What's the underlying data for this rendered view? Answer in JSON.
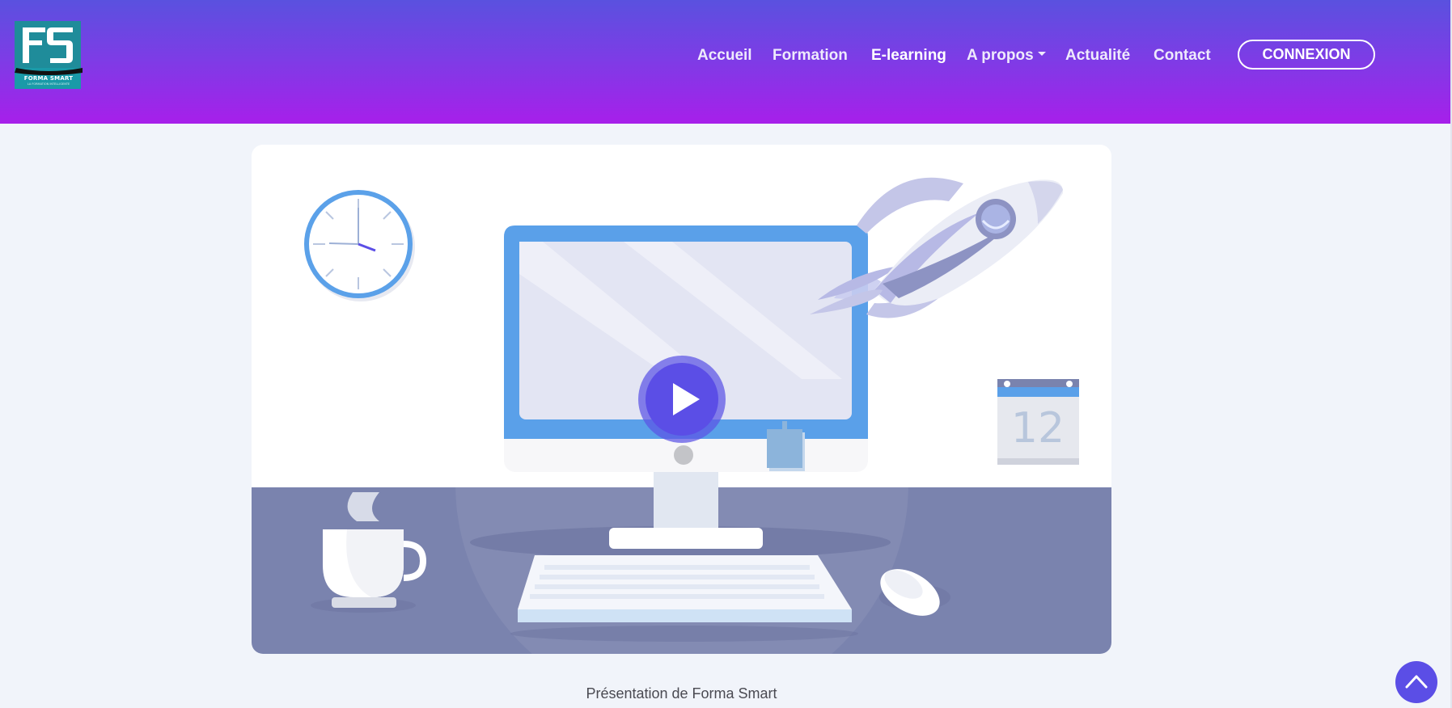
{
  "brand": {
    "logo_letters": "FS",
    "logo_name": "FORMA SMART",
    "logo_tagline": "LA FORMATION INTELLIGENTE"
  },
  "nav": {
    "items": [
      {
        "label": "Accueil"
      },
      {
        "label": "Formation"
      },
      {
        "label": "E-learning",
        "active": true
      },
      {
        "label": "A propos",
        "dropdown": true
      },
      {
        "label": "Actualité"
      },
      {
        "label": "Contact"
      }
    ],
    "login_label": "CONNEXION"
  },
  "video": {
    "thumbnail_icons": [
      "clock-icon",
      "rocket-icon",
      "calendar-icon",
      "monitor-icon",
      "coffee-cup-icon",
      "keyboard-icon",
      "mouse-icon"
    ],
    "calendar_day": "12",
    "play_icon": "play-icon"
  },
  "caption": "Présentation de Forma Smart",
  "back_to_top_icon": "chevron-up-icon",
  "colors": {
    "header_top": "#5a51df",
    "header_bottom": "#a71fea",
    "accent": "#5b4ee6",
    "monitor_blue": "#5aa0e9",
    "desk": "#7a83ae"
  }
}
